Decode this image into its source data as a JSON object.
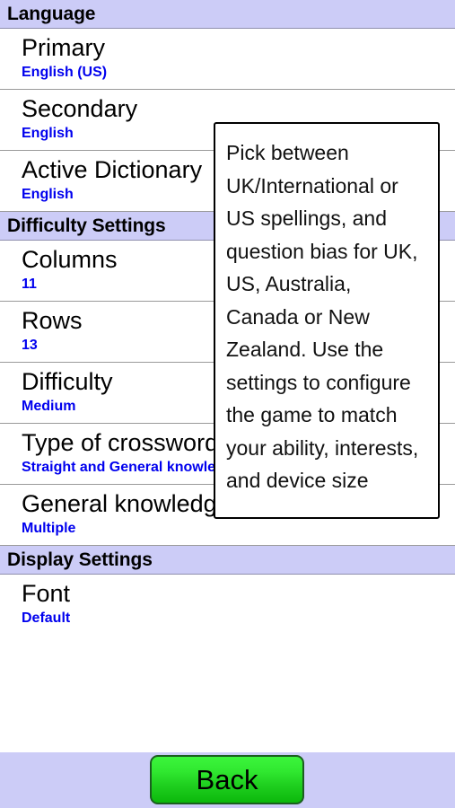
{
  "sections": [
    {
      "header": "Language",
      "rows": [
        {
          "title": "Primary",
          "value": "English (US)"
        },
        {
          "title": "Secondary",
          "value": "English"
        },
        {
          "title": "Active Dictionary",
          "value": "English"
        }
      ]
    },
    {
      "header": "Difficulty Settings",
      "rows": [
        {
          "title": "Columns",
          "value": "11"
        },
        {
          "title": "Rows",
          "value": "13"
        },
        {
          "title": "Difficulty",
          "value": "Medium"
        },
        {
          "title": "Type of crossword clues",
          "value": "Straight and General knowledge clues"
        },
        {
          "title": "General knowledge subjects",
          "value": "Multiple"
        }
      ]
    },
    {
      "header": "Display Settings",
      "rows": [
        {
          "title": "Font",
          "value": "Default"
        }
      ]
    }
  ],
  "tooltip": {
    "text": "Pick between UK/International or US spellings, and question bias for UK, US, Australia, Canada or New Zealand. Use the settings to configure the game to match your ability, interests, and device size"
  },
  "footer": {
    "back_label": "Back"
  },
  "colors": {
    "section_header_bg": "#ccccf7",
    "value_text": "#0000ee",
    "button_green_top": "#3cf53c",
    "button_green_bottom": "#0cb80c",
    "footer_bg": "#ccccf7"
  }
}
